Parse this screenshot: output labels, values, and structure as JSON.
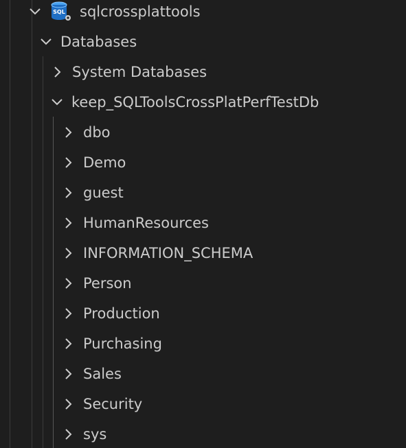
{
  "tree": {
    "server": {
      "label": "sqlcrossplattools",
      "expanded": true,
      "icon": "sql-server-icon",
      "icon_text": "SQL"
    },
    "databases": {
      "label": "Databases",
      "expanded": true
    },
    "system_databases": {
      "label": "System Databases",
      "expanded": false
    },
    "database": {
      "label": "keep_SQLToolsCrossPlatPerfTestDb",
      "expanded": true
    },
    "schemas": [
      {
        "label": "dbo",
        "expanded": false
      },
      {
        "label": "Demo",
        "expanded": false
      },
      {
        "label": "guest",
        "expanded": false
      },
      {
        "label": "HumanResources",
        "expanded": false
      },
      {
        "label": "INFORMATION_SCHEMA",
        "expanded": false
      },
      {
        "label": "Person",
        "expanded": false
      },
      {
        "label": "Production",
        "expanded": false
      },
      {
        "label": "Purchasing",
        "expanded": false
      },
      {
        "label": "Sales",
        "expanded": false
      },
      {
        "label": "Security",
        "expanded": false
      },
      {
        "label": "sys",
        "expanded": false
      }
    ]
  },
  "colors": {
    "background": "#1e1e1e",
    "text": "#cccccc",
    "guide": "#3c3c3c",
    "icon_blue": "#1f6fc5"
  }
}
